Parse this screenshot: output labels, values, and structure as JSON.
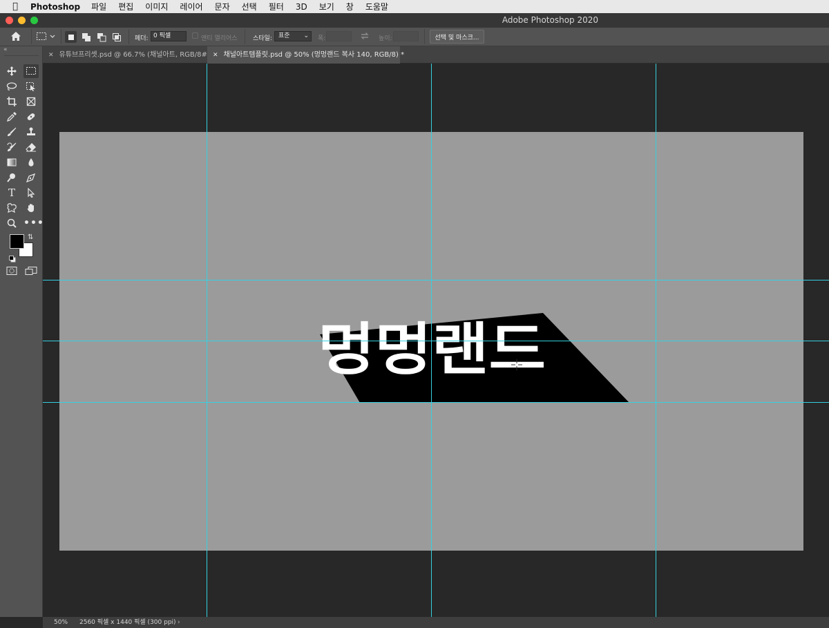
{
  "menubar": {
    "app_name": "Photoshop",
    "items": [
      "파일",
      "편집",
      "이미지",
      "레이어",
      "문자",
      "선택",
      "필터",
      "3D",
      "보기",
      "창",
      "도움말"
    ]
  },
  "window": {
    "title": "Adobe Photoshop 2020"
  },
  "options": {
    "feather_label": "페더:",
    "feather_value": "0 픽셀",
    "antialias_label": "앤티 앨리어스",
    "style_label": "스타일:",
    "style_value": "표준",
    "width_label": "폭:",
    "height_label": "높이:",
    "select_mask_label": "선택 및 마스크..."
  },
  "tabs": [
    {
      "label": "유튜브프리셋.psd @ 66.7% (채널아트, RGB/8#)",
      "active": false
    },
    {
      "label": "채널아트템플릿.psd @ 50% (멍멍랜드 복사 140, RGB/8) *",
      "active": true
    }
  ],
  "canvas": {
    "headline": "멍멍랜드",
    "artboard_color": "#9b9b9b",
    "guide_color": "#36d0e0"
  },
  "status": {
    "zoom": "50%",
    "doc_info": "2560 픽셀 x 1440 픽셀 (300 ppi)"
  },
  "colors": {
    "foreground": "#000000",
    "background": "#ffffff"
  },
  "icons": [
    "apple-icon",
    "home-icon",
    "marquee-icon",
    "move-icon",
    "lasso-icon",
    "crop-icon",
    "eyedropper-icon",
    "brush-icon",
    "eraser-icon",
    "gradient-icon",
    "dodge-icon",
    "type-icon",
    "hand-icon",
    "zoom-icon"
  ]
}
